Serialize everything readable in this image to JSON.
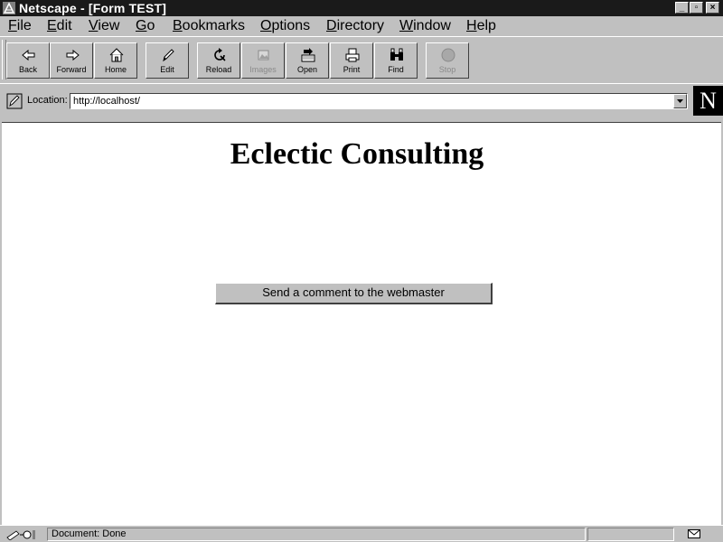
{
  "window": {
    "title": "Netscape - [Form TEST]",
    "min_glyph": "_",
    "max_glyph": "▫",
    "close_glyph": "×"
  },
  "menu": [
    {
      "label": "File",
      "key": "F",
      "rest": "ile"
    },
    {
      "label": "Edit",
      "key": "E",
      "rest": "dit"
    },
    {
      "label": "View",
      "key": "V",
      "rest": "iew"
    },
    {
      "label": "Go",
      "key": "G",
      "rest": "o"
    },
    {
      "label": "Bookmarks",
      "key": "B",
      "rest": "ookmarks"
    },
    {
      "label": "Options",
      "key": "O",
      "rest": "ptions"
    },
    {
      "label": "Directory",
      "key": "D",
      "rest": "irectory"
    },
    {
      "label": "Window",
      "key": "W",
      "rest": "indow"
    },
    {
      "label": "Help",
      "key": "H",
      "rest": "elp"
    }
  ],
  "toolbar": {
    "back": "Back",
    "forward": "Forward",
    "home": "Home",
    "edit": "Edit",
    "reload": "Reload",
    "images": "Images",
    "open": "Open",
    "print": "Print",
    "find": "Find",
    "stop": "Stop"
  },
  "location": {
    "label": "Location:",
    "url": "http://localhost/"
  },
  "brand": {
    "logo_letter": "N"
  },
  "page": {
    "heading": "Eclectic Consulting",
    "comment_button": "Send a comment to the webmaster"
  },
  "status": {
    "text": "Document: Done"
  },
  "icons": {
    "app": "netscape-app-icon",
    "back": "back-arrow-icon",
    "forward": "forward-arrow-icon",
    "home": "home-icon",
    "edit": "pencil-icon",
    "reload": "reload-icon",
    "images": "images-icon",
    "open": "open-location-icon",
    "print": "printer-icon",
    "find": "binoculars-icon",
    "stop": "stop-icon",
    "location": "bookmark-quickfile-icon",
    "security": "security-key-icon",
    "mail": "mail-envelope-icon"
  },
  "colors": {
    "chrome": "#c0c0c0",
    "titlebar": "#1a1a1a",
    "content_bg": "#ffffff",
    "logo_bg": "#000000"
  }
}
